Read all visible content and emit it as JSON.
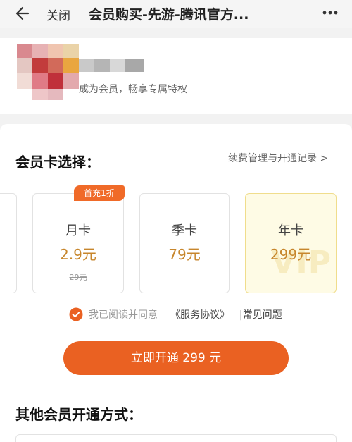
{
  "header": {
    "close_label": "关闭",
    "title": "会员购买-先游-腾讯官方..."
  },
  "profile": {
    "subtitle": "成为会员，畅享专属特权"
  },
  "membership": {
    "section_title": "会员卡选择：",
    "renew_link": "续费管理与开通记录 >",
    "plans": [
      {
        "name": "月卡",
        "price": "2.9元",
        "original_price": "29元",
        "badge": "首充1折",
        "selected": false
      },
      {
        "name": "季卡",
        "price": "79元",
        "selected": false
      },
      {
        "name": "年卡",
        "price": "299元",
        "selected": true,
        "watermark": "VIP"
      }
    ],
    "agreement": {
      "checked": true,
      "text": "我已阅读并同意",
      "link": "《服务协议》",
      "separator_link": "|常见问题"
    },
    "buy_button": "立即开通  299 元"
  },
  "other": {
    "title": "其他会员开通方式："
  },
  "colors": {
    "accent": "#ea6122",
    "price_gold": "#c7862c",
    "selected_bg": "#fefbe5"
  },
  "icons": [
    "back-arrow-icon",
    "more-dots-icon",
    "checkmark-circle-icon"
  ]
}
